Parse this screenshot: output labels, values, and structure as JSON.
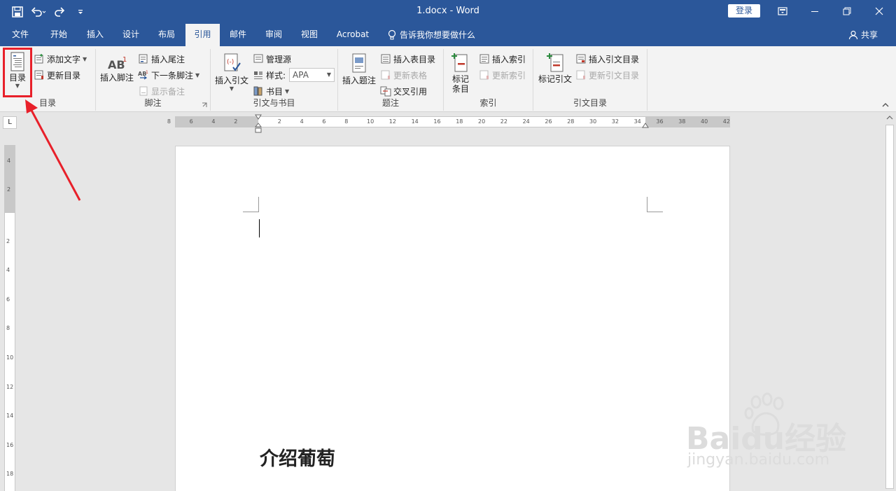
{
  "window": {
    "title": "1.docx  -  Word",
    "login_label": "登录"
  },
  "tabs": [
    {
      "label": "文件"
    },
    {
      "label": "开始"
    },
    {
      "label": "插入"
    },
    {
      "label": "设计"
    },
    {
      "label": "布局"
    },
    {
      "label": "引用"
    },
    {
      "label": "邮件"
    },
    {
      "label": "审阅"
    },
    {
      "label": "视图"
    },
    {
      "label": "Acrobat"
    }
  ],
  "tell_me": "告诉我你想要做什么",
  "share": "共享",
  "ribbon": {
    "toc": {
      "button": "目录",
      "add_text": "添加文字",
      "update_toc": "更新目录",
      "group_label": "目录"
    },
    "footnotes": {
      "insert_footnote": "插入脚注",
      "insert_endnote": "插入尾注",
      "next_footnote": "下一条脚注",
      "show_notes": "显示备注",
      "group_label": "脚注"
    },
    "citations": {
      "insert_citation": "插入引文",
      "manage_sources": "管理源",
      "style_label": "样式:",
      "style_value": "APA",
      "bibliography": "书目",
      "group_label": "引文与书目"
    },
    "captions": {
      "insert_caption": "插入题注",
      "insert_table_of_figures": "插入表目录",
      "update_table": "更新表格",
      "cross_reference": "交叉引用",
      "group_label": "题注"
    },
    "index": {
      "mark_entry": "标记\n条目",
      "insert_index": "插入索引",
      "update_index": "更新索引",
      "group_label": "索引"
    },
    "authorities": {
      "mark_citation": "标记引文",
      "insert_toa": "插入引文目录",
      "update_toa": "更新引文目录",
      "group_label": "引文目录"
    }
  },
  "ruler": {
    "h_left_ticks": [
      "8",
      "6",
      "4",
      "2"
    ],
    "h_ticks": [
      "2",
      "4",
      "6",
      "8",
      "10",
      "12",
      "14",
      "16",
      "18",
      "20",
      "22",
      "24",
      "26",
      "28",
      "30",
      "32",
      "34",
      "36",
      "38",
      "40",
      "42"
    ],
    "v_top_ticks": [
      "4",
      "2"
    ],
    "v_ticks": [
      "2",
      "4",
      "6",
      "8",
      "10",
      "12",
      "14",
      "16",
      "18"
    ],
    "tab_selector": "L"
  },
  "document": {
    "heading": "介绍葡萄"
  },
  "watermark": {
    "brand": "Baidu经验",
    "url": "jingyan.baidu.com"
  },
  "colors": {
    "title_bar": "#2b579a",
    "ribbon_bg": "#f3f3f3",
    "highlight": "#e8202a"
  }
}
